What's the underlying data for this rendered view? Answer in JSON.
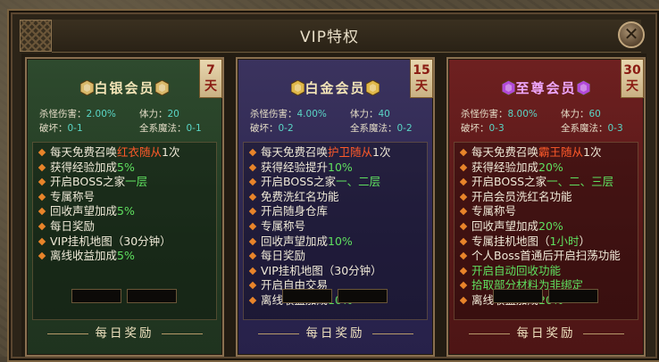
{
  "window": {
    "title": "VIP特权",
    "close_icon": "close-icon"
  },
  "panels": [
    {
      "id": "silver",
      "badge": "白银会员",
      "badge_color": "#f5e6b8",
      "gem_color": "#d8b86a",
      "days_num": "7",
      "days_unit": "天",
      "stats": {
        "kill_damage_label": "杀怪伤害：",
        "kill_damage": "2.00%",
        "stamina_label": "体力：",
        "stamina": "20",
        "break_label": "破坏：",
        "break": "0-1",
        "magic_label": "全系魔法：",
        "magic": "0-1"
      },
      "items": [
        [
          {
            "t": "每天免费召唤"
          },
          {
            "t": "红衣随从",
            "c": "red"
          },
          {
            "t": "1次"
          }
        ],
        [
          {
            "t": "获得经验加成"
          },
          {
            "t": "5%",
            "c": "green"
          }
        ],
        [
          {
            "t": "开启BOSS之家"
          },
          {
            "t": "一层",
            "c": "green"
          }
        ],
        [
          {
            "t": "专属称号"
          }
        ],
        [
          {
            "t": "回收声望加成"
          },
          {
            "t": "5%",
            "c": "green"
          }
        ],
        [
          {
            "t": "每日奖励"
          }
        ],
        [
          {
            "t": "VIP挂机地图（30分钟）"
          }
        ],
        [
          {
            "t": "离线收益加成"
          },
          {
            "t": "5%",
            "c": "green"
          }
        ]
      ],
      "reward_title": "每日奖励"
    },
    {
      "id": "platinum",
      "badge": "白金会员",
      "badge_color": "#f5e6b8",
      "gem_color": "#e0b84a",
      "days_num": "15",
      "days_unit": "天",
      "stats": {
        "kill_damage_label": "杀怪伤害：",
        "kill_damage": "4.00%",
        "stamina_label": "体力：",
        "stamina": "40",
        "break_label": "破坏：",
        "break": "0-2",
        "magic_label": "全系魔法：",
        "magic": "0-2"
      },
      "items": [
        [
          {
            "t": "每天免费召唤"
          },
          {
            "t": "护卫随从",
            "c": "red"
          },
          {
            "t": "1次"
          }
        ],
        [
          {
            "t": "获得经验提升"
          },
          {
            "t": "10%",
            "c": "green"
          }
        ],
        [
          {
            "t": "开启BOSS之家"
          },
          {
            "t": "一、二层",
            "c": "green"
          }
        ],
        [
          {
            "t": "免费洗红名功能"
          }
        ],
        [
          {
            "t": "开启随身仓库"
          }
        ],
        [
          {
            "t": "专属称号"
          }
        ],
        [
          {
            "t": "回收声望加成"
          },
          {
            "t": "10%",
            "c": "green"
          }
        ],
        [
          {
            "t": "每日奖励"
          }
        ],
        [
          {
            "t": "VIP挂机地图（30分钟）"
          }
        ],
        [
          {
            "t": "开启自由交易"
          }
        ],
        [
          {
            "t": "离线收益加成"
          },
          {
            "t": "10%",
            "c": "green"
          }
        ]
      ],
      "reward_title": "每日奖励"
    },
    {
      "id": "supreme",
      "badge": "至尊会员",
      "badge_color": "#f0a8ff",
      "gem_color": "#b24ad8",
      "days_num": "30",
      "days_unit": "天",
      "stats": {
        "kill_damage_label": "杀怪伤害：",
        "kill_damage": "8.00%",
        "stamina_label": "体力：",
        "stamina": "60",
        "break_label": "破坏：",
        "break": "0-3",
        "magic_label": "全系魔法：",
        "magic": "0-3"
      },
      "items": [
        [
          {
            "t": "每天免费召唤"
          },
          {
            "t": "霸王随从",
            "c": "red"
          },
          {
            "t": "1次"
          }
        ],
        [
          {
            "t": "获得经验加成"
          },
          {
            "t": "20%",
            "c": "green"
          }
        ],
        [
          {
            "t": "开启BOSS之家"
          },
          {
            "t": "一、二、三层",
            "c": "green"
          }
        ],
        [
          {
            "t": "开启会员洗红名功能"
          }
        ],
        [
          {
            "t": "专属称号"
          }
        ],
        [
          {
            "t": "回收声望加成"
          },
          {
            "t": "20%",
            "c": "green"
          }
        ],
        [
          {
            "t": "专属挂机地图（"
          },
          {
            "t": "1小时",
            "c": "green"
          },
          {
            "t": "）"
          }
        ],
        [
          {
            "t": "个人Boss首通后开启扫荡功能"
          }
        ],
        [
          {
            "t": "开启自动回收功能",
            "c": "green"
          }
        ],
        [
          {
            "t": "拾取部分材料为非绑定",
            "c": "green"
          }
        ],
        [
          {
            "t": "离线收益加成"
          },
          {
            "t": "20%",
            "c": "green"
          }
        ]
      ],
      "reward_title": "每日奖励"
    }
  ]
}
